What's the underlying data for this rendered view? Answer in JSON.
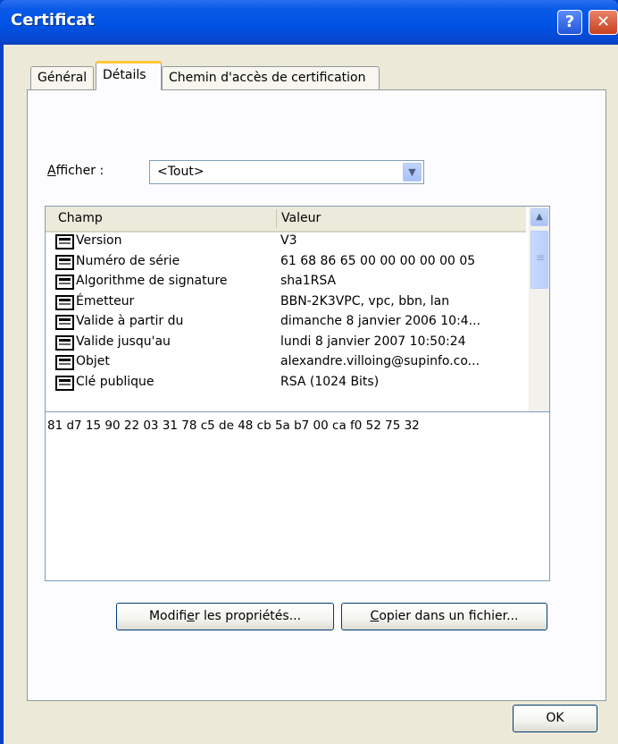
{
  "window": {
    "title": "Certificat",
    "help_label": "?",
    "close_label": "✕"
  },
  "tabs": [
    {
      "label": "Général"
    },
    {
      "label": "Détails"
    },
    {
      "label": "Chemin d'accès de certification"
    }
  ],
  "show": {
    "label_prefix": "A",
    "label_rest": "fficher :",
    "selected": "<Tout>"
  },
  "list": {
    "columns": [
      "Champ",
      "Valeur"
    ],
    "rows": [
      {
        "field": "Version",
        "value": "V3"
      },
      {
        "field": "Numéro de série",
        "value": "61 68 86 65 00 00 00 00 00 05"
      },
      {
        "field": "Algorithme de signature",
        "value": "sha1RSA"
      },
      {
        "field": "Émetteur",
        "value": "BBN-2K3VPC, vpc, bbn, lan"
      },
      {
        "field": "Valide à partir du",
        "value": "dimanche 8 janvier 2006 10:4..."
      },
      {
        "field": "Valide jusqu'au",
        "value": "lundi 8 janvier 2007 10:50:24"
      },
      {
        "field": "Objet",
        "value": "alexandre.villoing@supinfo.co..."
      },
      {
        "field": "Clé publique",
        "value": "RSA (1024 Bits)"
      }
    ]
  },
  "detail": {
    "text": "81 d7 15 90 22 03 31 78 c5 de 48 cb 5a b7 00 ca f0 52 75 32"
  },
  "buttons": {
    "edit_before": "Modifi",
    "edit_key": "e",
    "edit_after": "r les propriétés...",
    "copy_key": "C",
    "copy_after": "opier dans un fichier...",
    "ok": "OK"
  },
  "colors": {
    "titlebar": "#0053e3",
    "dialog_bg": "#ece9d8",
    "active_tab_accent": "#ffc73c"
  }
}
